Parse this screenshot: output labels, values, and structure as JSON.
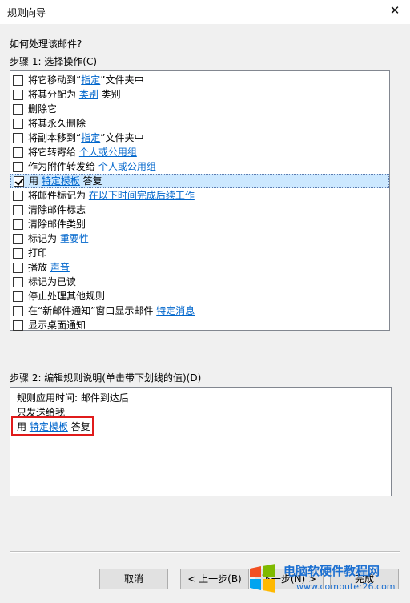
{
  "window": {
    "title": "规则向导",
    "close": "✕"
  },
  "prompt": "如何处理该邮件?",
  "step1": {
    "label": "步骤 1: 选择操作(C)",
    "items": [
      {
        "pre": "将它移动到“",
        "link": "指定",
        "post": "”文件夹中",
        "checked": false
      },
      {
        "pre": "将其分配为 ",
        "link": "类别",
        "post": " 类别",
        "checked": false
      },
      {
        "pre": "删除它",
        "link": "",
        "post": "",
        "checked": false
      },
      {
        "pre": "将其永久删除",
        "link": "",
        "post": "",
        "checked": false
      },
      {
        "pre": "将副本移到“",
        "link": "指定",
        "post": "”文件夹中",
        "checked": false
      },
      {
        "pre": "将它转寄给 ",
        "link": "个人或公用组",
        "post": "",
        "checked": false
      },
      {
        "pre": "作为附件转发给 ",
        "link": "个人或公用组",
        "post": "",
        "checked": false
      },
      {
        "pre": "用 ",
        "link": "特定模板",
        "post": " 答复",
        "checked": true
      },
      {
        "pre": "将邮件标记为 ",
        "link": "在以下时间完成后续工作",
        "post": "",
        "checked": false
      },
      {
        "pre": "清除邮件标志",
        "link": "",
        "post": "",
        "checked": false
      },
      {
        "pre": "清除邮件类别",
        "link": "",
        "post": "",
        "checked": false
      },
      {
        "pre": "标记为 ",
        "link": "重要性",
        "post": "",
        "checked": false
      },
      {
        "pre": "打印",
        "link": "",
        "post": "",
        "checked": false
      },
      {
        "pre": "播放 ",
        "link": "声音",
        "post": "",
        "checked": false
      },
      {
        "pre": "标记为已读",
        "link": "",
        "post": "",
        "checked": false
      },
      {
        "pre": "停止处理其他规则",
        "link": "",
        "post": "",
        "checked": false
      },
      {
        "pre": "在“新邮件通知”窗口显示邮件 ",
        "link": "特定消息",
        "post": "",
        "checked": false
      },
      {
        "pre": "显示桌面通知",
        "link": "",
        "post": "",
        "checked": false
      }
    ]
  },
  "step2": {
    "label": "步骤 2: 编辑规则说明(单击带下划线的值)(D)",
    "line1": "规则应用时间: 邮件到达后",
    "line2": "只发送给我",
    "line3_pre": "用 ",
    "line3_link": "特定模板",
    "line3_post": " 答复"
  },
  "buttons": {
    "cancel": "取消",
    "back": "< 上一步(B)",
    "next": "下一步(N) >",
    "finish": "完成"
  },
  "watermark": {
    "title": "电脑软硬件教程网",
    "url": "www.computer26.com"
  }
}
